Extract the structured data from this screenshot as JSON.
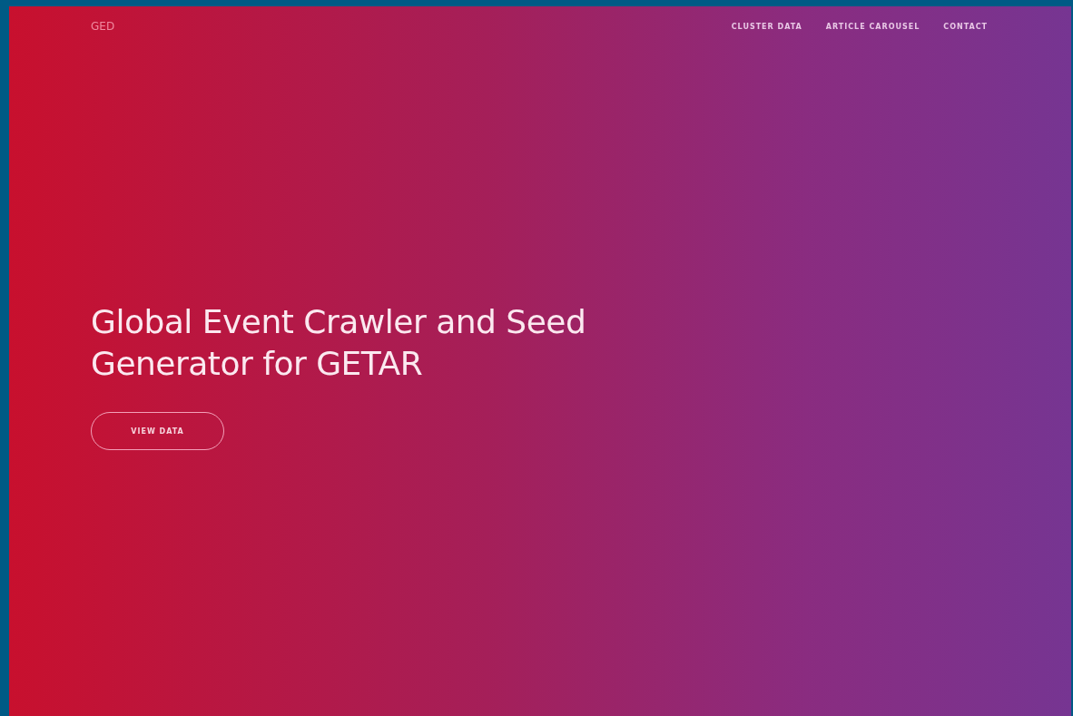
{
  "logo": "GED",
  "nav": [
    "CLUSTER DATA",
    "ARTICLE CAROUSEL",
    "CONTACT"
  ],
  "hero": {
    "title": "Global Event Crawler and Seed Generator for GETAR",
    "button": "VIEW DATA"
  }
}
